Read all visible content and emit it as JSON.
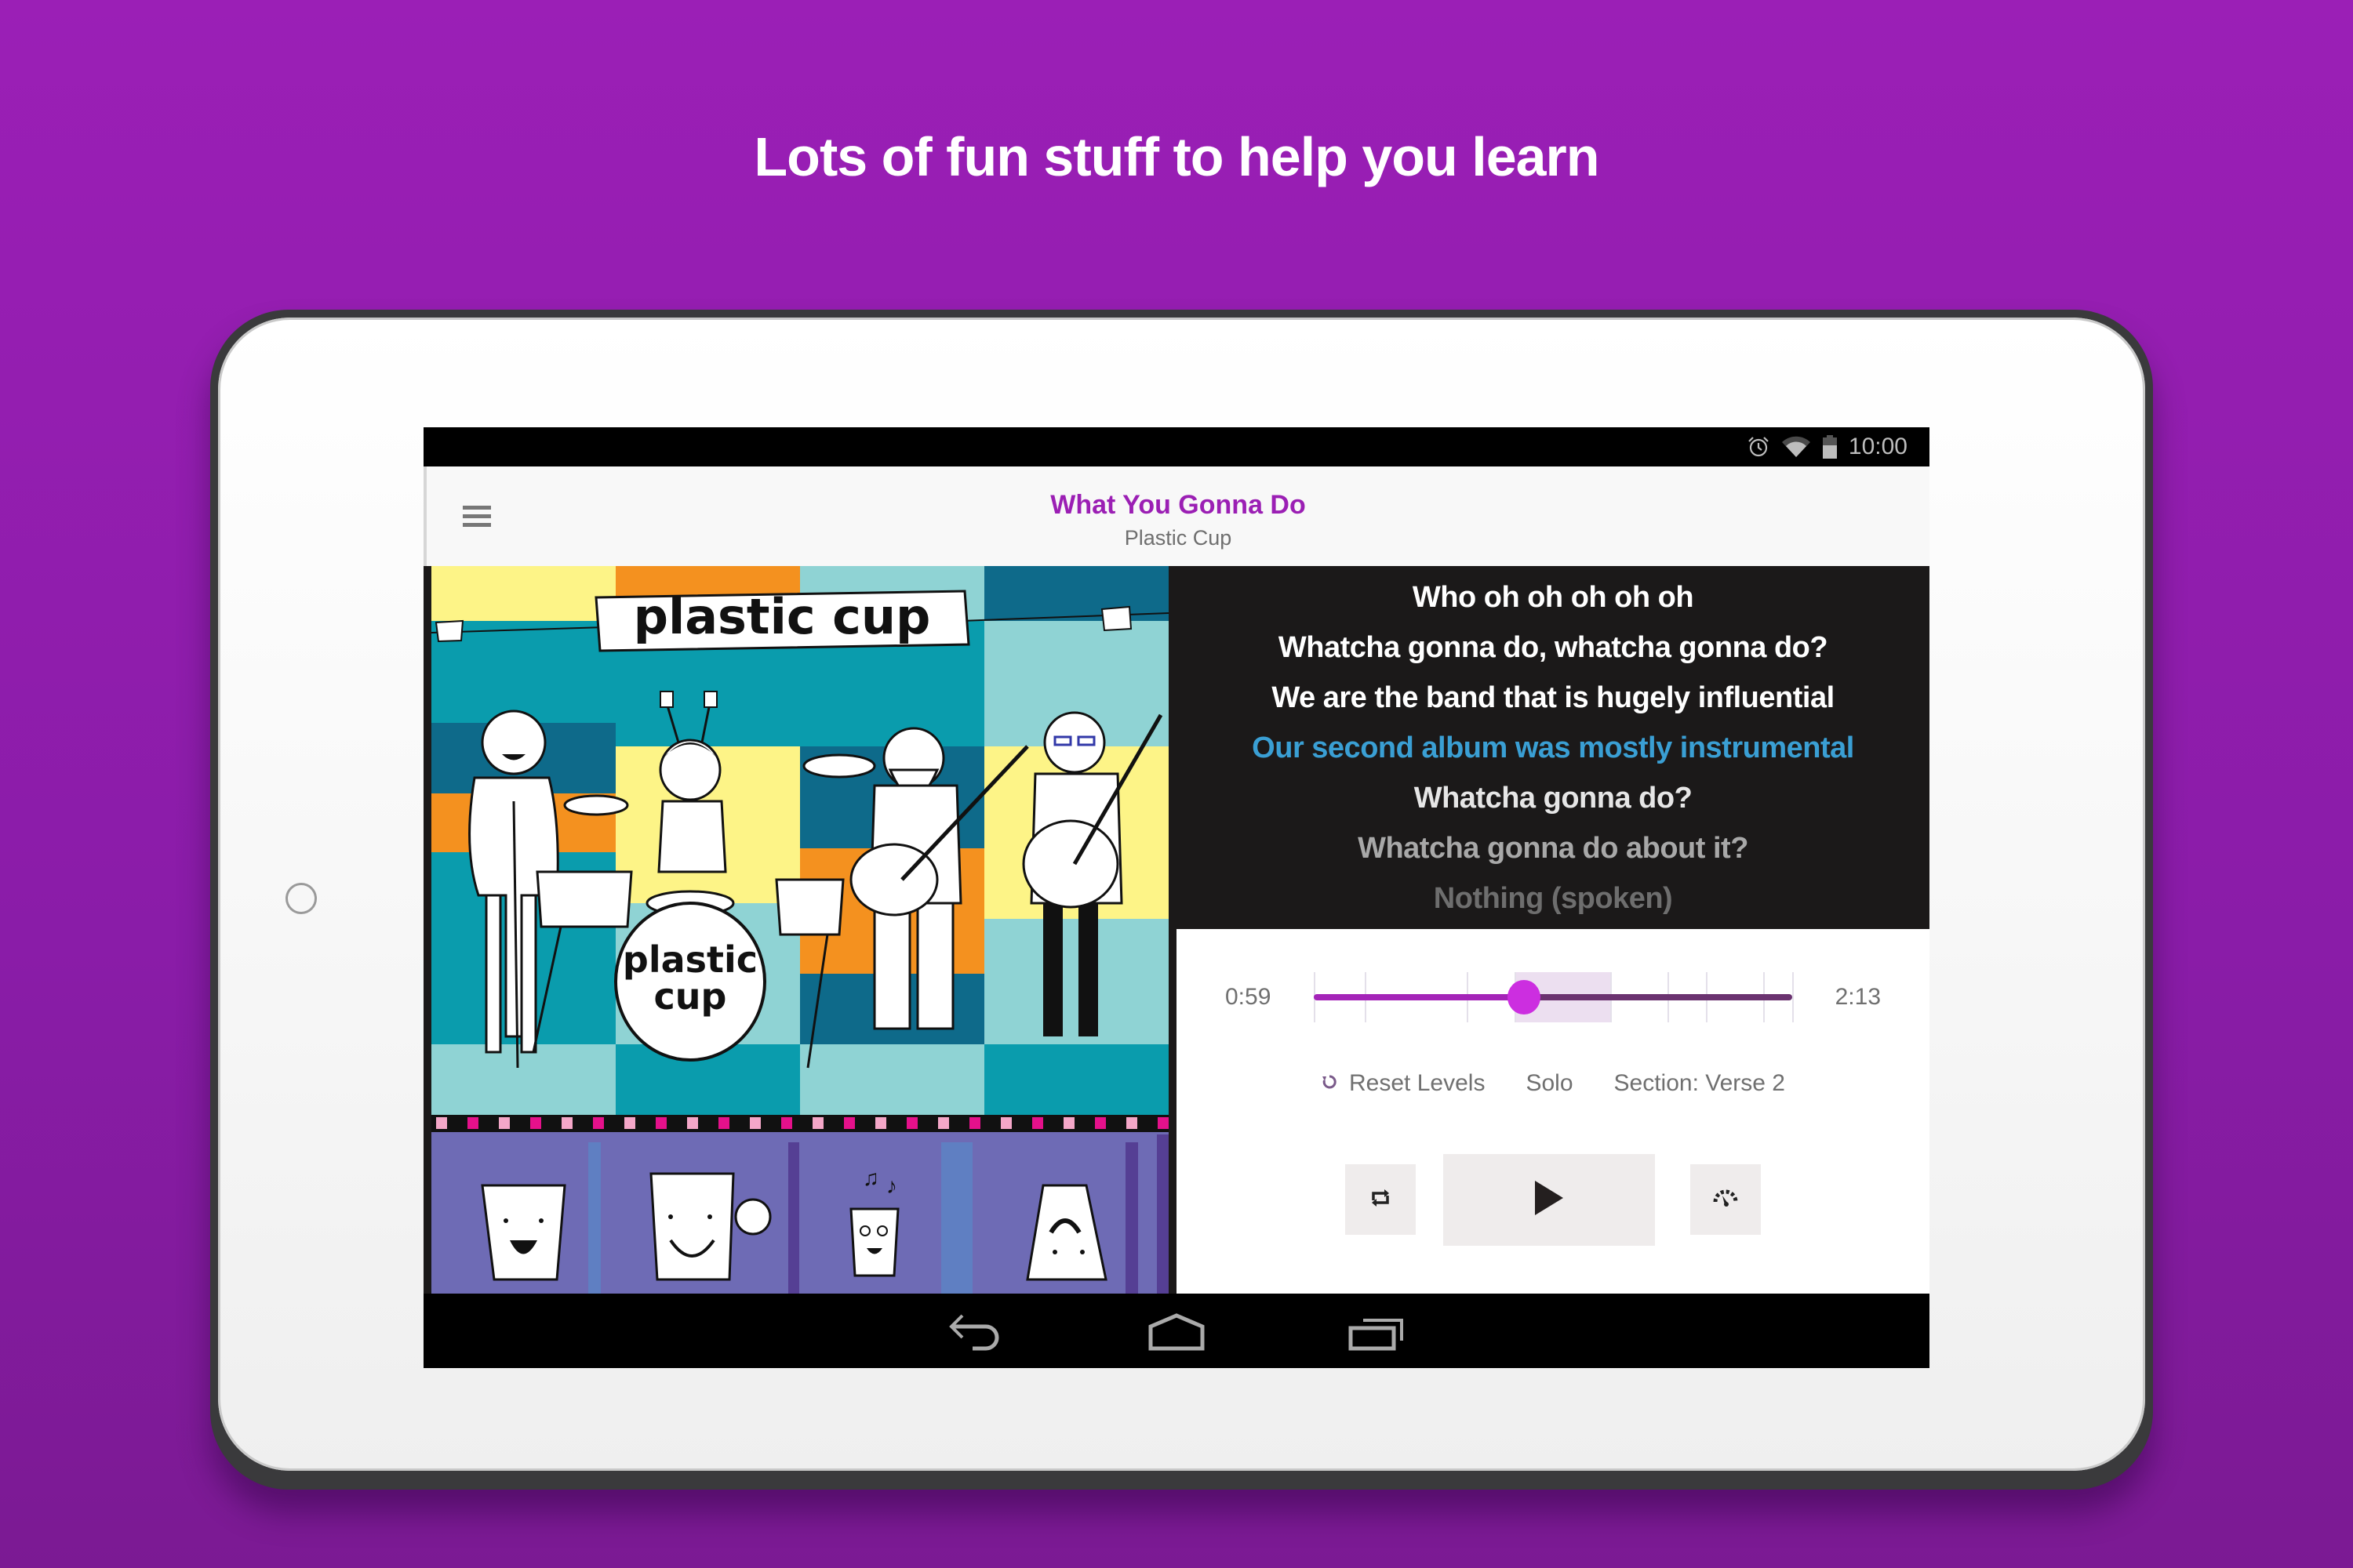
{
  "headline": "Lots of fun stuff to help you learn",
  "status_bar": {
    "time": "10:00",
    "icons": [
      "alarm-icon",
      "wifi-icon",
      "battery-icon"
    ]
  },
  "app_bar": {
    "menu_icon": "hamburger-menu-icon",
    "song_title": "What You Gonna Do",
    "artist": "Plastic Cup"
  },
  "album_art": {
    "band_name": "plastic cup",
    "drum_text_line1": "plastic",
    "drum_text_line2": "cup"
  },
  "lyrics": {
    "active_index": 3,
    "lines": [
      {
        "text": "Who oh oh oh oh oh",
        "state": "past"
      },
      {
        "text": "Whatcha gonna do, whatcha gonna do?",
        "state": "past"
      },
      {
        "text": "We are the band that is hugely influential",
        "state": "past"
      },
      {
        "text": "Our second album was mostly instrumental",
        "state": "current"
      },
      {
        "text": "Whatcha gonna do?",
        "state": "upcoming"
      },
      {
        "text": "Whatcha gonna do about it?",
        "state": "upcoming"
      },
      {
        "text": "Nothing (spoken)",
        "state": "upcoming"
      }
    ],
    "colors": {
      "past": "#ffffff",
      "current": "#3a9fd4",
      "upcoming": [
        "#e6e6e6",
        "#a8a8a8",
        "#6e6e6e"
      ]
    }
  },
  "player": {
    "current_time": "0:59",
    "total_time": "2:13",
    "progress_fraction": 0.44,
    "section_start_fraction": 0.42,
    "section_end_fraction": 0.62,
    "section_marker_fractions": [
      0,
      0.107,
      0.32,
      0.42,
      0.62,
      0.74,
      0.82,
      0.94,
      1.0
    ],
    "colors": {
      "played": "#a424b8",
      "remaining": "#6b3370",
      "thumb": "#cc2ee0",
      "section_band": "#ecdff0"
    },
    "options": {
      "reset_levels": "Reset Levels",
      "solo": "Solo",
      "section": "Section: Verse 2"
    },
    "buttons": {
      "loop": "repeat-icon",
      "play": "play-icon",
      "speed": "speedometer-icon"
    }
  },
  "nav_bar": {
    "back": "back-icon",
    "home": "home-icon",
    "recents": "recents-icon"
  },
  "brand_color": "#9b1fb6"
}
